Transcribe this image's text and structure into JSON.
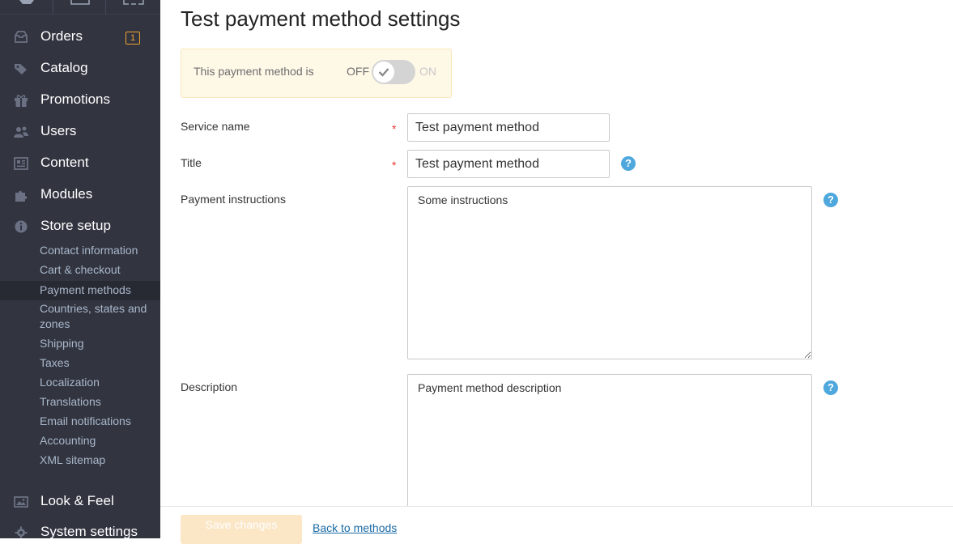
{
  "sidebar": {
    "top_icons": [
      "gear-icon",
      "window-icon",
      "expand-icon"
    ],
    "items": [
      {
        "label": "Orders",
        "icon": "inbox-icon",
        "badge": "1"
      },
      {
        "label": "Catalog",
        "icon": "tag-icon"
      },
      {
        "label": "Promotions",
        "icon": "gift-icon"
      },
      {
        "label": "Users",
        "icon": "users-icon"
      },
      {
        "label": "Content",
        "icon": "content-icon"
      },
      {
        "label": "Modules",
        "icon": "puzzle-icon"
      },
      {
        "label": "Store setup",
        "icon": "info-icon"
      }
    ],
    "sub_items": [
      "Contact information",
      "Cart & checkout",
      "Payment methods",
      "Countries, states and zones",
      "Shipping",
      "Taxes",
      "Localization",
      "Translations",
      "Email notifications",
      "Accounting",
      "XML sitemap"
    ],
    "active_sub_item": "Payment methods",
    "bottom_items": [
      {
        "label": "Look & Feel",
        "icon": "image-icon"
      },
      {
        "label": "System settings",
        "icon": "gear-icon"
      }
    ]
  },
  "main": {
    "title": "Test payment method settings",
    "status": {
      "label": "This payment method is",
      "off": "OFF",
      "on": "ON"
    },
    "fields": {
      "service_name": {
        "label": "Service name",
        "required_mark": "*",
        "value": "Test payment method"
      },
      "title": {
        "label": "Title",
        "required_mark": "*",
        "value": "Test payment method",
        "help": "?"
      },
      "payment_instructions": {
        "label": "Payment instructions",
        "value": "Some instructions",
        "help": "?"
      },
      "description": {
        "label": "Description",
        "value": "Payment method description",
        "help": "?"
      }
    },
    "footer": {
      "save_label": "Save changes",
      "back_label": "Back to methods"
    }
  },
  "colors": {
    "sidebar_bg": "#323540",
    "sub_item_text": "#a9b7ca",
    "badge": "#f0a030",
    "help": "#4fa8dd",
    "required": "#e53935",
    "link": "#1a6aa5"
  }
}
